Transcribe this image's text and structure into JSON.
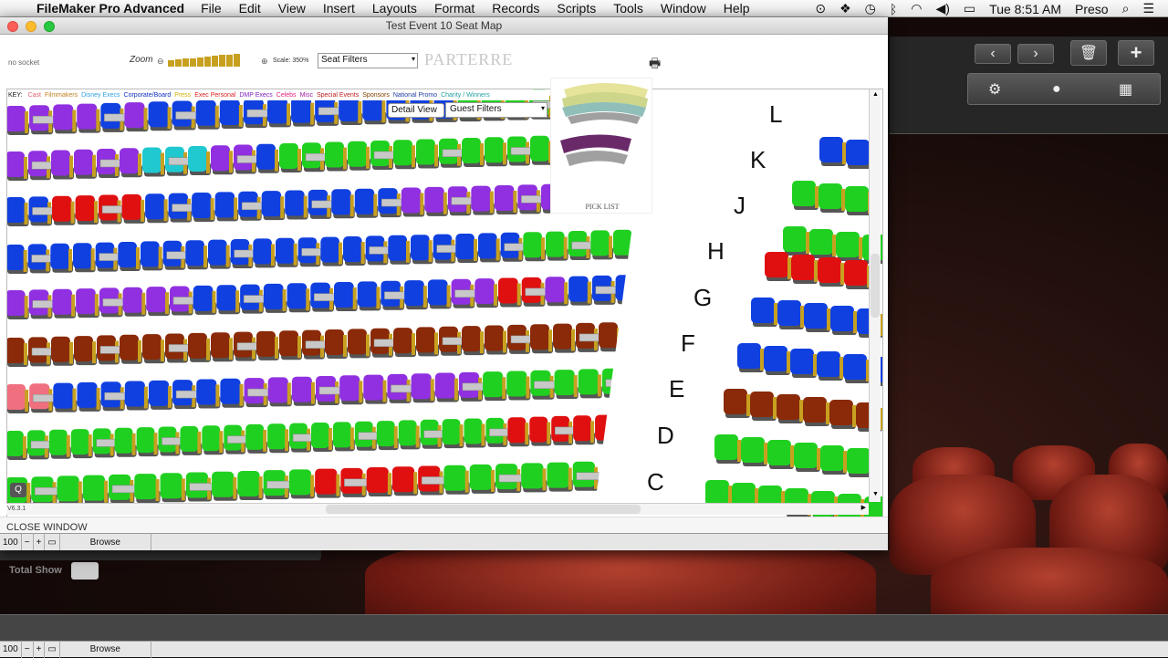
{
  "menubar": {
    "app_name": "FileMaker Pro Advanced",
    "items": [
      "File",
      "Edit",
      "View",
      "Insert",
      "Layouts",
      "Format",
      "Records",
      "Scripts",
      "Tools",
      "Window",
      "Help"
    ],
    "clock": "Tue 8:51 AM",
    "user": "Preso"
  },
  "window": {
    "title": "Test Event 10 Seat Map",
    "no_socket": "no socket",
    "zoom_label": "Zoom",
    "scale_label": "Scale: 350%",
    "seat_filters": "Seat Filters",
    "section_name": "PARTERRE",
    "detail_view": "Detail View",
    "guest_filters": "Guest Filters",
    "key_label": "KEY:",
    "key_items": [
      {
        "label": "Cast",
        "color": "#e06070"
      },
      {
        "label": "Filmmakers",
        "color": "#c08020"
      },
      {
        "label": "Disney Execs",
        "color": "#30a0e0"
      },
      {
        "label": "Corporate/Board",
        "color": "#1030c0"
      },
      {
        "label": "Press",
        "color": "#d0b000"
      },
      {
        "label": "Exec Personal",
        "color": "#e02020"
      },
      {
        "label": "DMP Execs",
        "color": "#8020c0"
      },
      {
        "label": "Celebs",
        "color": "#e02080"
      },
      {
        "label": "Misc",
        "color": "#a020a0"
      },
      {
        "label": "Special Events",
        "color": "#c02020"
      },
      {
        "label": "Sponsors",
        "color": "#804000"
      },
      {
        "label": "National Promo",
        "color": "#2040a0"
      },
      {
        "label": "Charity / Winners",
        "color": "#20a0a0"
      }
    ],
    "pick_list": "PICK LIST",
    "version": "V6.3.1",
    "close_window": "CLOSE WINDOW",
    "row_labels": [
      "L",
      "K",
      "J",
      "H",
      "G",
      "F",
      "E",
      "D",
      "C"
    ],
    "status_zoom": "100",
    "status_mode": "Browse"
  },
  "background": {
    "total_show": "Total Show",
    "status_zoom": "100",
    "status_mode": "Browse"
  },
  "colors": {
    "blue": "#1040e0",
    "purple": "#9030e0",
    "green": "#20d020",
    "red": "#e01010",
    "brown": "#8a2a08",
    "cyan": "#20c8d0",
    "pink": "#f07080",
    "dark_green": "#20603a",
    "gray_arrow": "#c8c8c8"
  }
}
